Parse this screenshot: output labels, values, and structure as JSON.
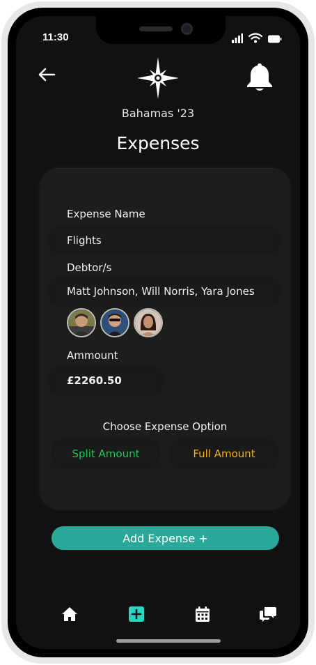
{
  "status_bar": {
    "time": "11:30"
  },
  "header": {
    "trip_name": "Bahamas '23",
    "title": "Expenses"
  },
  "form": {
    "expense_name_label": "Expense Name",
    "expense_name_value": "Flights",
    "debtors_label": "Debtor/s",
    "debtors_value": "Matt Johnson, Will Norris, Yara Jones",
    "amount_label": "Ammount",
    "amount_value": "£2260.50",
    "option_label": "Choose Expense Option",
    "split_option": "Split Amount",
    "full_option": "Full Amount"
  },
  "actions": {
    "add_expense": "Add Expense +"
  },
  "colors": {
    "accent": "#2aa99b",
    "split": "#22c55e",
    "full": "#f2b21b",
    "nav_active": "#2ad6c0"
  },
  "icons": {
    "back": "arrow-left-icon",
    "logo": "compass-star-icon",
    "notifications": "bell-icon",
    "nav": [
      "home-icon",
      "add-square-icon",
      "calendar-icon",
      "chat-icon"
    ]
  }
}
